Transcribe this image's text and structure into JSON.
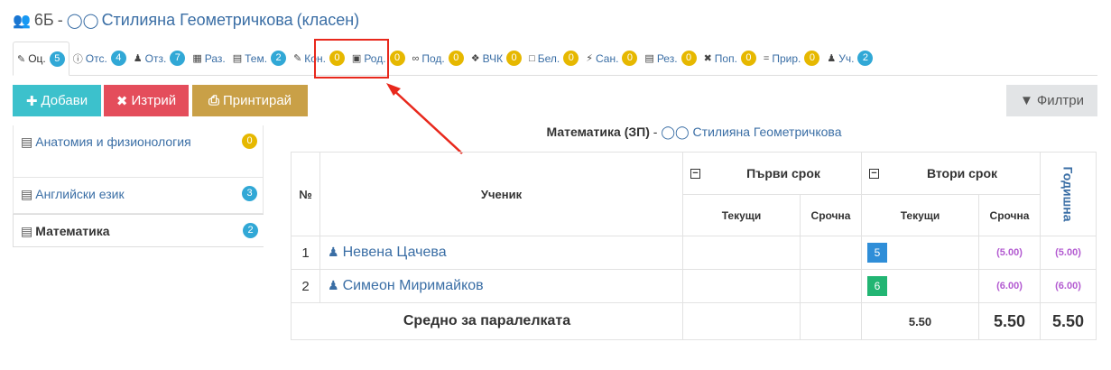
{
  "header": {
    "class_name": "6Б",
    "teacher": "Стилияна Геометричкова",
    "role": "(класен)"
  },
  "tabs": [
    {
      "icon": "pencil-icon",
      "label": "Оц.",
      "count": "5",
      "color": "blue",
      "active": true
    },
    {
      "icon": "info-icon",
      "label": "Отс.",
      "count": "4",
      "color": "blue"
    },
    {
      "icon": "users-icon",
      "label": "Отз.",
      "count": "7",
      "color": "blue"
    },
    {
      "icon": "table-icon",
      "label": "Раз.",
      "count": ""
    },
    {
      "icon": "list-icon",
      "label": "Тем.",
      "count": "2",
      "color": "blue"
    },
    {
      "icon": "edit-icon",
      "label": "Кон.",
      "count": "0",
      "color": "yellow"
    },
    {
      "icon": "calendar-icon",
      "label": "Род.",
      "count": "0",
      "color": "yellow"
    },
    {
      "icon": "handshake-icon",
      "label": "Под.",
      "count": "0",
      "color": "yellow"
    },
    {
      "icon": "handshake-icon",
      "label": "ВЧК",
      "count": "0",
      "color": "yellow"
    },
    {
      "icon": "note-icon",
      "label": "Бел.",
      "count": "0",
      "color": "yellow"
    },
    {
      "icon": "bolt-icon",
      "label": "Сан.",
      "count": "0",
      "color": "yellow"
    },
    {
      "icon": "doc-icon",
      "label": "Рез.",
      "count": "0",
      "color": "yellow"
    },
    {
      "icon": "tools-icon",
      "label": "Поп.",
      "count": "0",
      "color": "yellow"
    },
    {
      "icon": "equals-icon",
      "label": "Прир.",
      "count": "0",
      "color": "yellow"
    },
    {
      "icon": "student-icon",
      "label": "Уч.",
      "count": "2",
      "color": "blue"
    }
  ],
  "toolbar": {
    "add": "Добави",
    "delete": "Изтрий",
    "print": "Принтирай",
    "filter": "Филтри"
  },
  "subjects": [
    {
      "name": "Анатомия и физионология",
      "count": "0",
      "color": "yellow"
    },
    {
      "name": "Английски език",
      "count": "3",
      "color": "blue"
    },
    {
      "name": "Математика",
      "count": "2",
      "color": "blue",
      "active": true
    }
  ],
  "grades": {
    "subject": "Математика (ЗП)",
    "teacher": "Стилияна Геометричкова",
    "headers": {
      "num": "№",
      "student": "Ученик",
      "term1": "Първи срок",
      "term2": "Втори срок",
      "current": "Текущи",
      "term_grade": "Срочна",
      "year": "Годишна"
    },
    "rows": [
      {
        "num": "1",
        "name": "Невена Цачева",
        "t2_current": "5",
        "t2_term": "(5.00)",
        "year": "(5.00)"
      },
      {
        "num": "2",
        "name": "Симеон Миримайков",
        "t2_current": "6",
        "t2_term": "(6.00)",
        "year": "(6.00)"
      }
    ],
    "footer": {
      "label": "Средно за паралелката",
      "t2_current_avg": "5.50",
      "t2_term_avg": "5.50",
      "year_avg": "5.50"
    }
  },
  "colors": {
    "blue_badge": "#31a8d6",
    "yellow_badge": "#e6b800",
    "add_button": "#3cc1cc",
    "delete_button": "#e44d5b",
    "print_button": "#c9a047",
    "highlight": "#e8281c"
  }
}
